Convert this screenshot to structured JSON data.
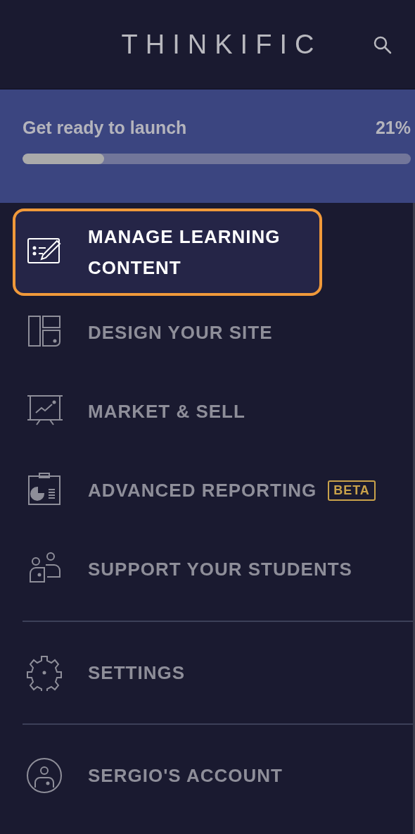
{
  "header": {
    "logo": "THINKIFIC"
  },
  "launch_progress": {
    "label": "Get ready to launch",
    "reading": "21%",
    "level": 0.21
  },
  "menu_sections": [
    {
      "items": [
        {
          "label": "MANAGE LEARNING CONTENT",
          "selected": true
        },
        {
          "label": "DESIGN YOUR SITE",
          "selected": false
        },
        {
          "label": "MARKET & SELL",
          "selected": false
        },
        {
          "label": "ADVANCED REPORTING",
          "selected": false,
          "badge": "BETA"
        },
        {
          "label": "SUPPORT YOUR STUDENTS",
          "selected": false
        }
      ]
    },
    {
      "items": [
        {
          "label": "SETTINGS",
          "selected": false
        }
      ]
    },
    {
      "items": [
        {
          "label": "SERGIO'S ACCOUNT",
          "selected": false
        }
      ]
    }
  ]
}
